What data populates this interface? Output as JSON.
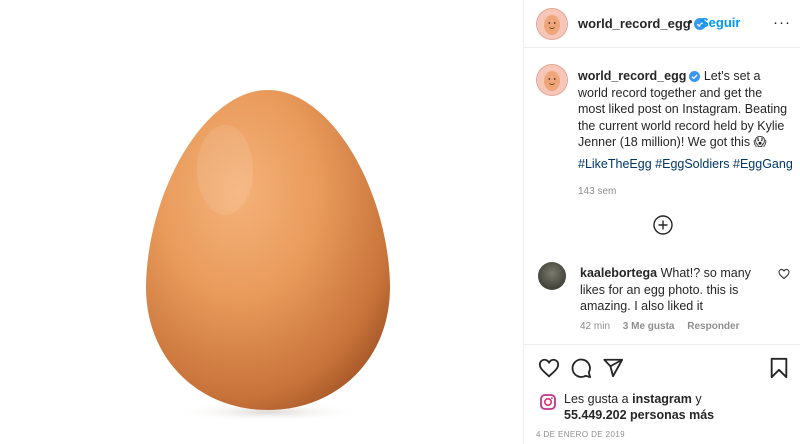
{
  "post": {
    "username": "world_record_egg",
    "follow_label": "Seguir",
    "separator": "•",
    "more_label": "···"
  },
  "caption": {
    "username": "world_record_egg",
    "text": " Let's set a world record together and get the most liked post on Instagram. Beating the current world record held by Kylie Jenner (18 million)! We got this 😱",
    "hashtags": [
      "#LikeTheEgg",
      "#EggSoldiers",
      "#EggGang"
    ],
    "time": "143 sem"
  },
  "comment": {
    "username": "kaalebortega",
    "text": " What!? so many likes for an egg photo. this is amazing. I also liked it",
    "time": "42 min",
    "likes": "3 Me gusta",
    "reply": "Responder"
  },
  "likes": {
    "prefix": "Les gusta a ",
    "user": "instagram",
    "mid": " y",
    "count": "55.449.202 personas más"
  },
  "date": "4 DE ENERO DE 2019",
  "colors": {
    "link": "#0095f6",
    "hashtag": "#00376b",
    "muted": "#8e8e8e",
    "egg": "#e59a5c"
  },
  "icons": [
    "verified-icon",
    "more-icon",
    "add-circle-icon",
    "heart-icon",
    "comment-icon",
    "share-icon",
    "bookmark-icon"
  ]
}
